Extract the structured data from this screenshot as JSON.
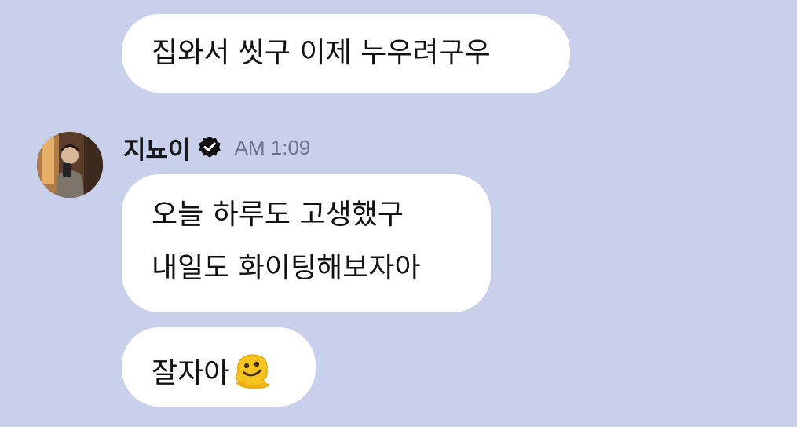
{
  "messages": [
    {
      "lines": [
        "집와서 씻구 이제 누우려구우"
      ]
    },
    {
      "lines": [
        "오늘 하루도 고생했구",
        "내일도 화이팅해보자아"
      ]
    },
    {
      "lines": [
        "잘자아"
      ],
      "emoji": "melting-face-icon"
    }
  ],
  "sender": {
    "name": "지뇨이",
    "time": "AM 1:09",
    "verified_icon": "verified-check-icon",
    "avatar": "profile-photo-avatar"
  },
  "colors": {
    "background": "#c8d0ec",
    "bubble": "#ffffff",
    "timestamp": "#6d7189",
    "verified_badge": "#111111"
  }
}
